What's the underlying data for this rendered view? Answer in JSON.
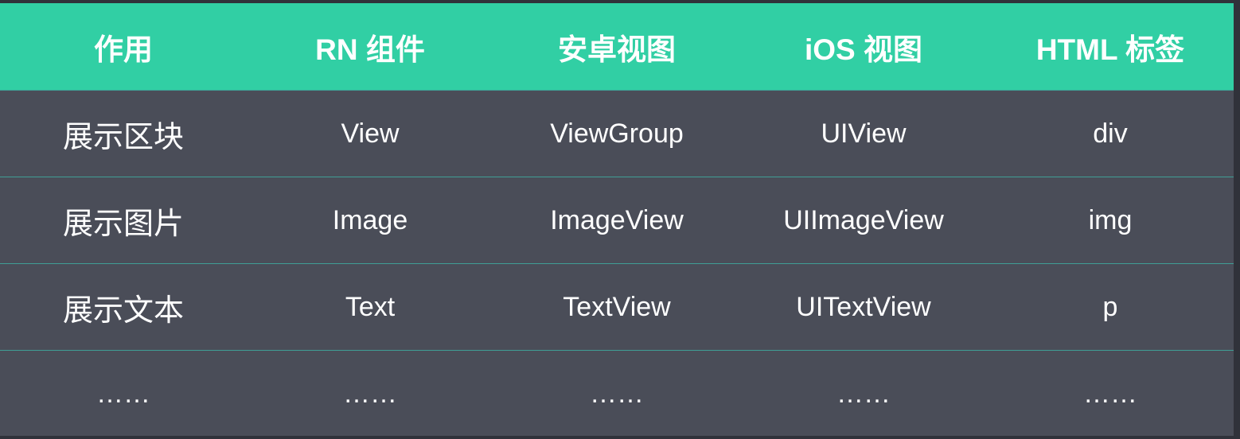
{
  "table": {
    "headers": [
      "作用",
      "RN 组件",
      "安卓视图",
      "iOS 视图",
      "HTML 标签"
    ],
    "rows": [
      [
        "展示区块",
        "View",
        "ViewGroup",
        "UIView",
        "div"
      ],
      [
        "展示图片",
        "Image",
        "ImageView",
        "UIImageView",
        "img"
      ],
      [
        "展示文本",
        "Text",
        "TextView",
        "UITextView",
        "p"
      ],
      [
        "……",
        "……",
        "……",
        "……",
        "……"
      ]
    ]
  },
  "colors": {
    "header_bg": "#31cfa4",
    "body_bg": "#4a4d58",
    "divider": "#3f9e95",
    "text": "#ffffff"
  }
}
